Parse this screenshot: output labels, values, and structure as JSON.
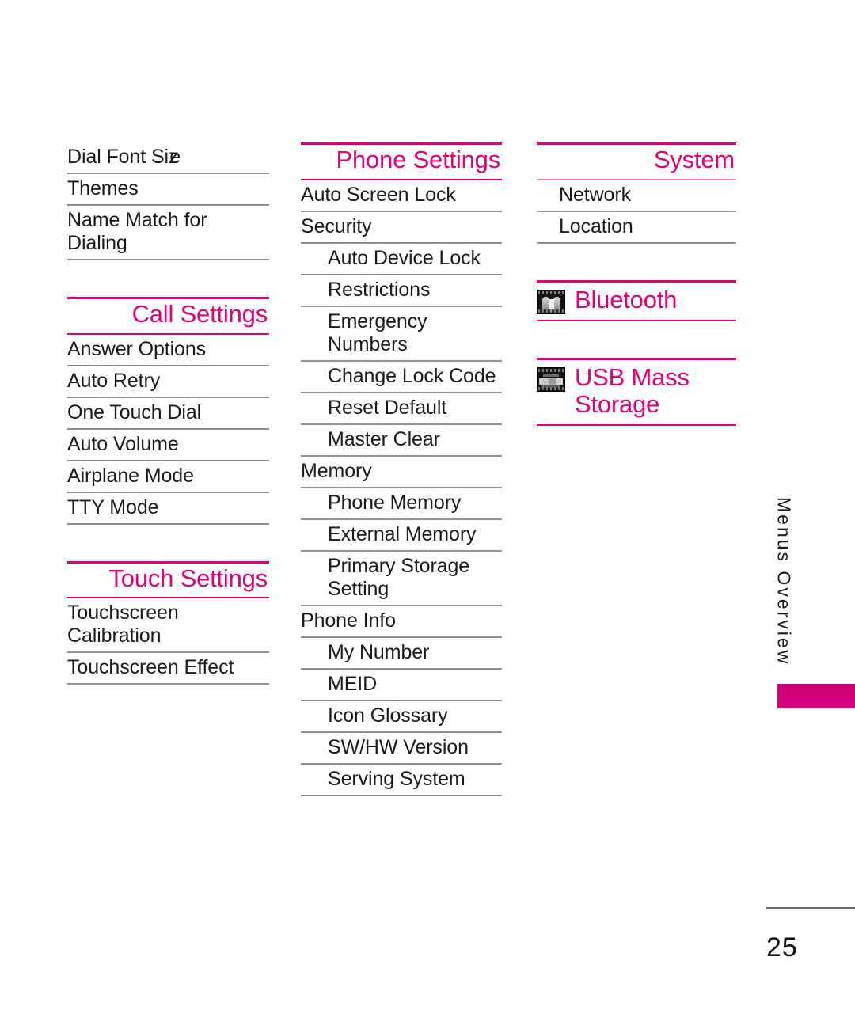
{
  "document": {
    "page_number": "25",
    "side_tab_label": "Menus Overview",
    "accent_color": "#e0007a",
    "tab_color": "#d3007c",
    "rule_color": "#8f8f8f"
  },
  "columns": [
    {
      "name": "column-left",
      "sections": [
        {
          "id": "continued-settings",
          "title": null,
          "has_header": false,
          "items": [
            {
              "label": "Dial Font Size",
              "level": 0,
              "artifact": "overlap-ze"
            },
            {
              "label": "Themes",
              "level": 0
            },
            {
              "label": "Name Match for\nDialing",
              "level": 0
            }
          ]
        },
        {
          "id": "call-settings",
          "title": "Call Settings",
          "has_header": true,
          "items": [
            {
              "label": "Answer Options",
              "level": 0
            },
            {
              "label": "Auto Retry",
              "level": 0
            },
            {
              "label": "One Touch Dial",
              "level": 0
            },
            {
              "label": "Auto Volume",
              "level": 0
            },
            {
              "label": "Airplane Mode",
              "level": 0
            },
            {
              "label": "TTY Mode",
              "level": 0
            }
          ]
        },
        {
          "id": "touch-settings",
          "title": "Touch Settings",
          "has_header": true,
          "items": [
            {
              "label": "Touchscreen\nCalibration",
              "level": 0
            },
            {
              "label": "Touchscreen Effect",
              "level": 0
            }
          ]
        }
      ]
    },
    {
      "name": "column-middle",
      "sections": [
        {
          "id": "phone-settings",
          "title": "Phone Settings",
          "has_header": true,
          "items": [
            {
              "label": "Auto Screen Lock",
              "level": 0
            },
            {
              "label": "Security",
              "level": 0
            },
            {
              "label": "Auto Device Lock",
              "level": 1
            },
            {
              "label": "Restrictions",
              "level": 1
            },
            {
              "label": "Emergency\nNumbers",
              "level": 1
            },
            {
              "label": "Change Lock Code",
              "level": 1
            },
            {
              "label": "Reset Default",
              "level": 1
            },
            {
              "label": "Master Clear",
              "level": 1
            },
            {
              "label": "Memory",
              "level": 0
            },
            {
              "label": "Phone Memory",
              "level": 1
            },
            {
              "label": "External Memory",
              "level": 1
            },
            {
              "label": "Primary Storage\nSetting",
              "level": 1
            },
            {
              "label": "Phone Info",
              "level": 0
            },
            {
              "label": "My Number",
              "level": 1
            },
            {
              "label": "MEID",
              "level": 1
            },
            {
              "label": "Icon Glossary",
              "level": 1
            },
            {
              "label": "SW/HW Version",
              "level": 1
            },
            {
              "label": "Serving System",
              "level": 1
            }
          ]
        }
      ]
    },
    {
      "name": "column-right",
      "sections": [
        {
          "id": "system",
          "title": "System",
          "has_header": true,
          "light_bottom_rule": true,
          "items": [
            {
              "label": "Network",
              "level": 0
            },
            {
              "label": "Location",
              "level": 0
            }
          ]
        },
        {
          "id": "bluetooth",
          "title": "Bluetooth",
          "has_header": true,
          "icon": "phone-screenshot-bluetooth-icon",
          "items": []
        },
        {
          "id": "usb-mass-storage",
          "title": "USB Mass\nStorage",
          "has_header": true,
          "icon": "phone-screenshot-usb-icon",
          "items": []
        }
      ]
    }
  ]
}
